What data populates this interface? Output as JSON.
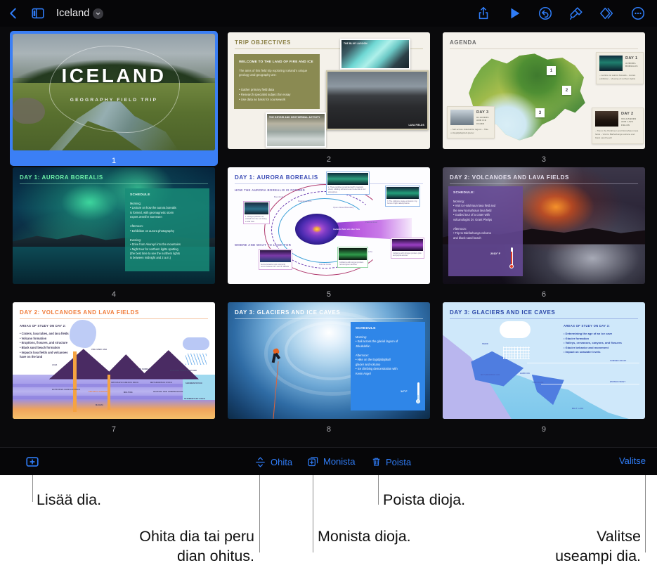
{
  "window": {
    "document_title": "Iceland"
  },
  "topbar": {
    "back_icon": "chevron-left-icon",
    "sidebar_icon": "sidebar-toggle-icon",
    "title_menu_icon": "chevron-down-icon",
    "actions": [
      {
        "name": "share-icon",
        "label": "Share"
      },
      {
        "name": "play-icon",
        "label": "Play"
      },
      {
        "name": "undo-icon",
        "label": "Undo"
      },
      {
        "name": "format-brush-icon",
        "label": "Format"
      },
      {
        "name": "animate-icon",
        "label": "Animate"
      },
      {
        "name": "more-options-icon",
        "label": "More"
      }
    ]
  },
  "bottom_toolbar": {
    "add_slide": {
      "icon": "plus-in-box-icon",
      "label": ""
    },
    "skip": {
      "icon": "skip-slide-icon",
      "label": "Ohita"
    },
    "duplicate": {
      "icon": "duplicate-slide-icon",
      "label": "Monista"
    },
    "delete": {
      "icon": "trash-icon",
      "label": "Poista"
    },
    "select": {
      "label": "Valitse"
    }
  },
  "callouts": [
    {
      "id": "add-slide",
      "text": "Lisää dia.",
      "align": "left"
    },
    {
      "id": "skip-slide",
      "text": "Ohita dia tai peru\ndian ohitus.",
      "align": "right"
    },
    {
      "id": "duplicate-slide",
      "text": "Monista dioja.",
      "align": "left"
    },
    {
      "id": "delete-slide",
      "text": "Poista dioja.",
      "align": "left"
    },
    {
      "id": "select-multiple",
      "text": "Valitse\nuseampi dia.",
      "align": "right"
    }
  ],
  "slides": [
    {
      "number": "1",
      "selected": true,
      "title": "ICELAND",
      "subtitle": "GEOGRAPHY FIELD TRIP"
    },
    {
      "number": "2",
      "selected": false,
      "title": "TRIP OBJECTIVES",
      "panel_heading": "WELCOME TO THE LAND OF FIRE AND ICE",
      "panel_paragraph": "The aims of this field trip exploring Iceland's unique geology and geography are:",
      "panel_bullets": [
        "• Gather primary field data",
        "• Research specialist subject for essay",
        "• Use data as basis for coursework"
      ],
      "photo_captions": [
        "THE BLUE\nLAGOON",
        "LAVA FIELDS",
        "THE GEYSIR AND\nGEOTHERMAL ACTIVITY"
      ]
    },
    {
      "number": "3",
      "selected": false,
      "title": "AGENDA",
      "map_pins": [
        "1",
        "2",
        "3"
      ],
      "cards": [
        {
          "day": "DAY 1",
          "subject": "AURORA\nBOREALIS",
          "lines": "– Lecture on aurora borealis\n– Aurora exhibition\n– Viewing of northern lights"
        },
        {
          "day": "DAY 2",
          "subject": "VOLCANOES\nAND LAVA FIELDS",
          "lines": "– Trip to the Holuhraun and Nornahraun lava fields\n– Visit to Bárðarbunga volcano and black sand beach"
        },
        {
          "day": "DAY 3",
          "subject": "GLACIERS AND\nICE CAVES",
          "lines": "– Sail across Jökulsárlón lagoon\n– Hike on Eyjafjallajökull glacier"
        }
      ]
    },
    {
      "number": "4",
      "selected": false,
      "title": "DAY 1: AURORA BOREALIS",
      "schedule_heading": "SCHEDULE",
      "schedule_body": "Morning:\n• Lecture on how the aurora borealis\n   is formed, with geomagnetic storm\n   expert Jennifer Sorensen\n\nAfternoon:\n• Exhibition on aurora photography\n\nEvening:\n• Drive from Akureyri into the mountains\n• Night tour for northern lights spotting\n   (the best time to see the northern lights\n   is between midnight and 2 a.m.)"
    },
    {
      "number": "5",
      "selected": false,
      "title": "DAY 1: AURORA BOREALIS",
      "subhead_1": "HOW THE AURORA BOREALIS IS FORMED",
      "subhead_2": "WHERE AND WHAT TO LOOK FOR",
      "annotations": [
        "Bow shock",
        "Magnetosphere",
        "Magnetopause",
        "Open-Closed Boundary",
        "Plasma sheet",
        "Radiation Belts\nVan Allen Belts",
        "Closed Field Lines",
        "Auroral Ovals",
        "Lobe"
      ],
      "callout_boxes": [
        "1. Charged particles are emitted from the sun during a solar flare",
        "2. These particles penetrate Earth's magnetic shield, colliding with atoms and molecules in our atmosphere",
        "3. The collisions create emissions: tiny bursts of light called photons",
        "Aurora borealis most commonly occurs between 60° and 75° latitude",
        "Collisions with oxygen produce red and green auroras",
        "Collisions with nitrogen produce pink and purple auroras"
      ]
    },
    {
      "number": "6",
      "selected": false,
      "title": "DAY 2: VOLCANOES AND LAVA FIELDS",
      "schedule_heading": "SCHEDULE:",
      "schedule_body": "Morning:\n• Visit to Holuhraun lava field and\n   the new Nornahraun lava field\n• Guided tour of a crater with\n   volcanologist Dr. Grant Phelps\n\nAfternoon:\n• Trip to Bárðarbunga volcano\n   and black sand beach",
      "temperature": "2010° F"
    },
    {
      "number": "7",
      "selected": false,
      "title": "DAY 2: VOLCANOES AND LAVA FIELDS",
      "areas_heading": "AREAS OF STUDY ON DAY 2:",
      "areas_bullets": [
        "• Craters, lava tubes, and lava fields",
        "• Volcano formation",
        "• Eruptions, fissures, and structure",
        "• Black sand beach formation",
        "• Impacts lava fields and volcanoes",
        "   have on the land"
      ],
      "diagram_labels": [
        "VOLCANIC ASH",
        "LAVA",
        "EROSION FROM WEATHER",
        "UPLIFT TO SURFACE",
        "INTRUSIVE IGNEOUS ROCK",
        "METAMORPHIC ROCK",
        "EXTRUSIVE IGNEOUS ROCK",
        "CRYSTALLIZATION",
        "MELTING",
        "HEATING AND COMPRESSION",
        "SEDIMENTATION",
        "SEDIMENTARY ROCK",
        "MAGMA"
      ]
    },
    {
      "number": "8",
      "selected": false,
      "title": "DAY 3: GLACIERS AND ICE CAVES",
      "schedule_heading": "SCHEDULE",
      "schedule_body": "Morning:\n• Sail across the glacial lagoon of\n   Jökulsárlón\n\nAfternoon:\n• Hike on the Eyjafjallajökull\n   glacier and volcano\n• Ice climbing demonstration with\n   Kevin Angel",
      "temperature": "14° F"
    },
    {
      "number": "9",
      "selected": false,
      "title": "DAY 3: GLACIERS AND ICE CAVES",
      "areas_heading": "AREAS OF STUDY ON DAY 3:",
      "areas_bullets": [
        "• Determining the age of an ice cave",
        "• Glacier formation",
        "• Valleys, crevasses, canyons, and fissures",
        "• Glacier behavior and movement",
        "• Impact on seawater levels"
      ],
      "diagram_labels": [
        "SNOW",
        "METAMORPHIC ICE",
        "HARD ICE",
        "CREVASSE",
        "SUMMER FROST",
        "WINTER FROST",
        "MELT LAKE"
      ]
    }
  ],
  "colors": {
    "accent_blue": "#2f7cf6",
    "selection_blue": "#3b7ff5",
    "app_background": "#0a0a0c",
    "toolbar_background": "#060608",
    "callout_text": "#111111",
    "leader_line": "#8c8c8c"
  }
}
